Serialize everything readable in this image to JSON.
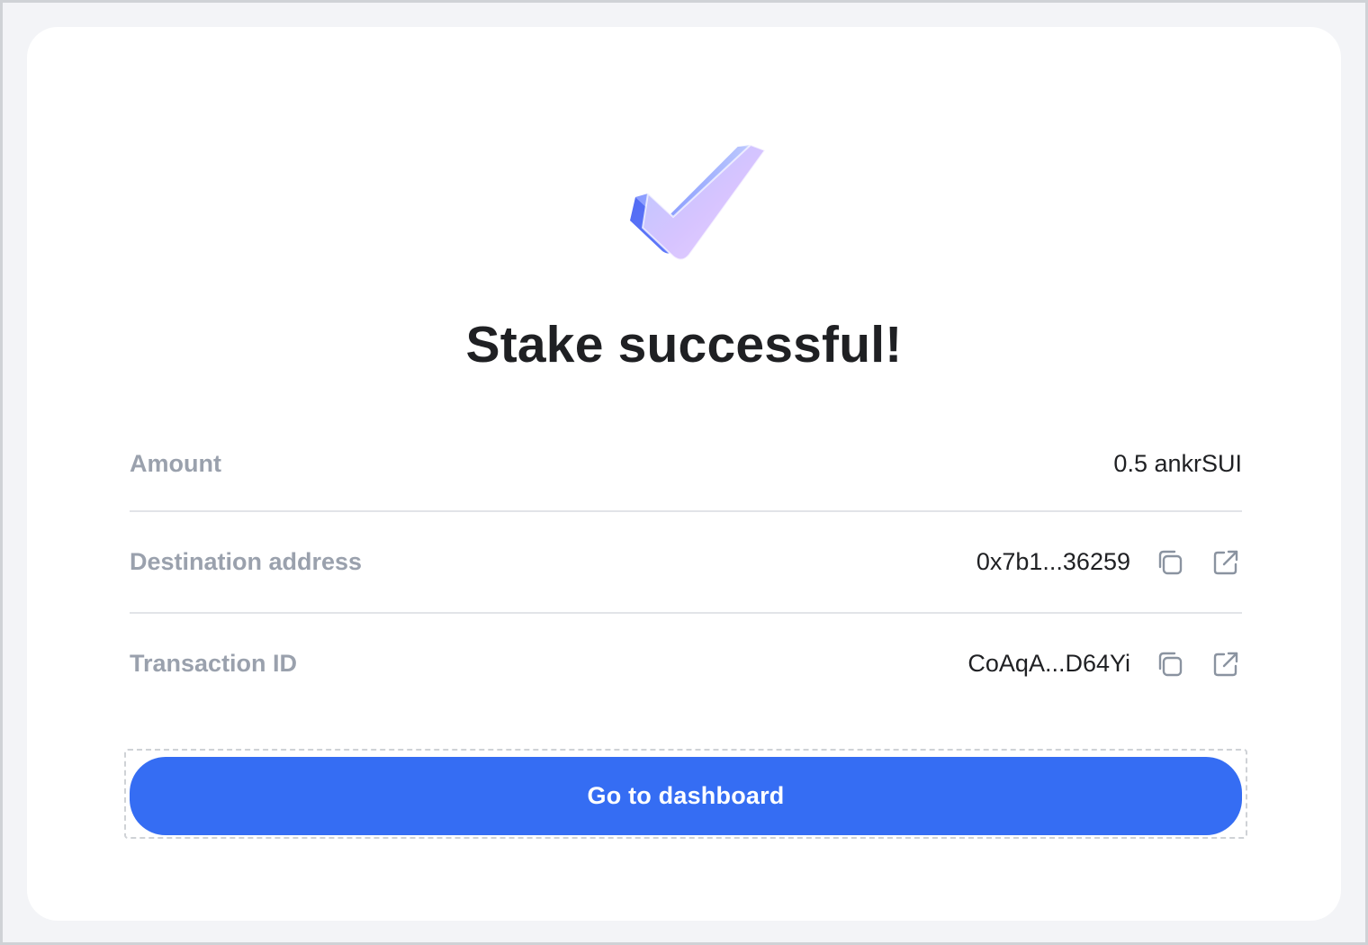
{
  "modal": {
    "title": "Stake successful!",
    "success_icon": "check-3d-icon",
    "rows": [
      {
        "label": "Amount",
        "value": "0.5 ankrSUI"
      },
      {
        "label": "Destination address",
        "value": "0x7b1...36259",
        "actions": [
          "copy-icon",
          "external-link-icon"
        ]
      },
      {
        "label": "Transaction ID",
        "value": "CoAqA...D64Yi",
        "actions": [
          "copy-icon",
          "external-link-icon"
        ]
      }
    ],
    "primary_button": "Go to dashboard"
  },
  "colors": {
    "background": "#f3f4f7",
    "card": "#ffffff",
    "title": "#1f2023",
    "label": "#9aa1ad",
    "divider": "#e2e4e8",
    "button": "#356df3",
    "button_text": "#ffffff",
    "icon": "#8a93a0"
  }
}
